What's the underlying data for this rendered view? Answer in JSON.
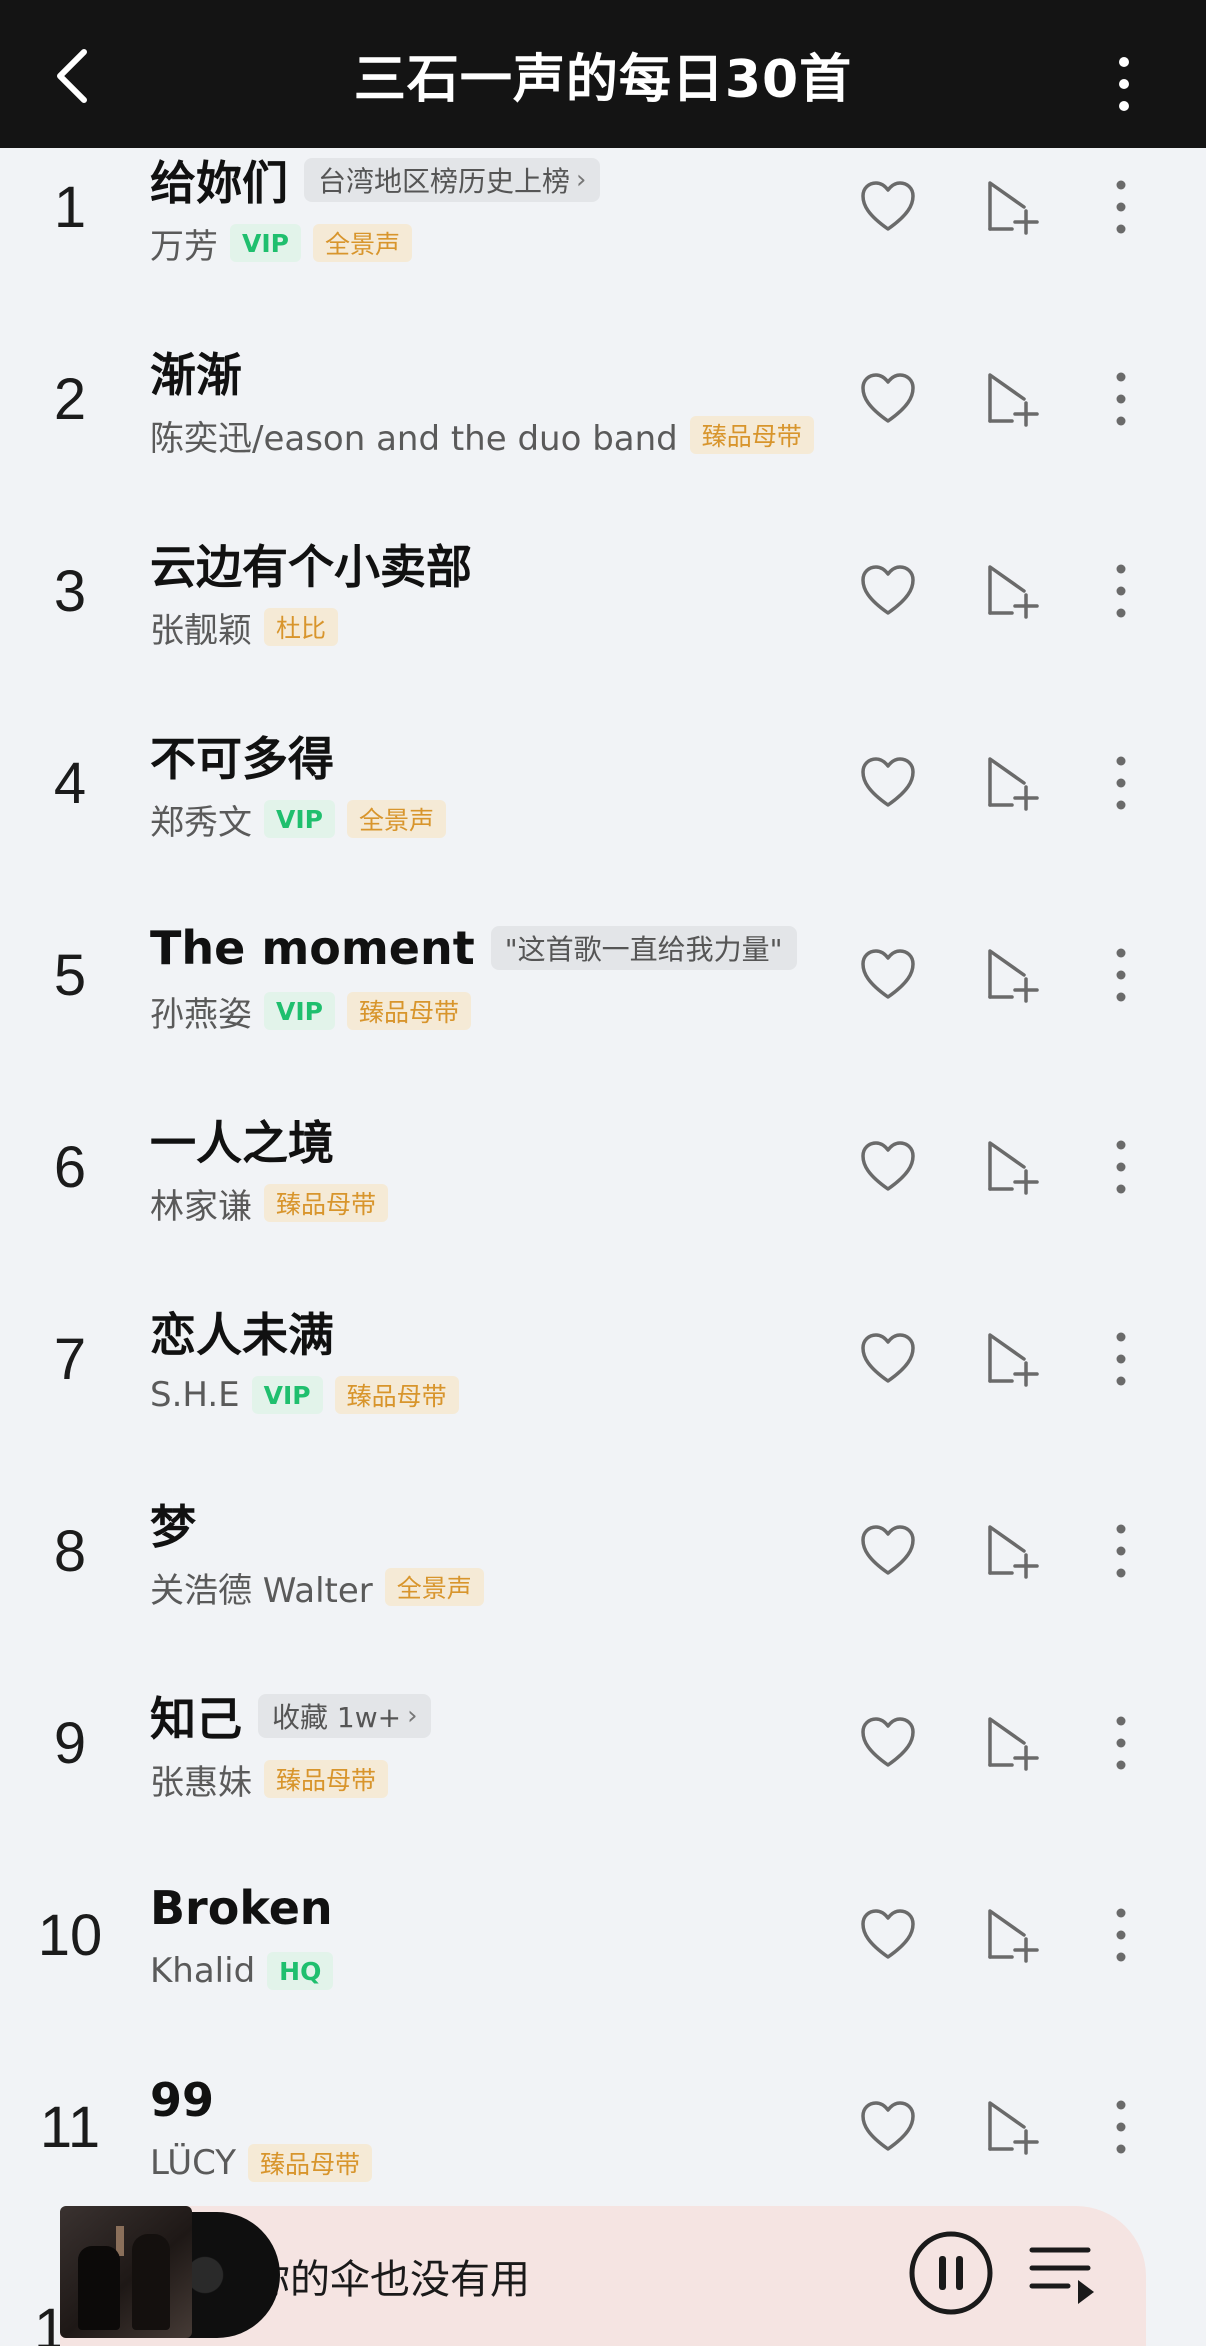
{
  "header": {
    "title": "三石一声的每日30首",
    "back_icon": "chevron-left-icon",
    "more_icon": "vertical-ellipsis-icon"
  },
  "songs": [
    {
      "index": "1",
      "title": "给妳们",
      "pill": "台湾地区榜历史上榜",
      "artist": "万芳",
      "tags": [
        {
          "text": "VIP",
          "kind": "vip"
        },
        {
          "text": "全景声",
          "kind": "gold"
        }
      ]
    },
    {
      "index": "2",
      "title": "渐渐",
      "artist": "陈奕迅/eason and the duo band",
      "tags": [
        {
          "text": "臻品母带",
          "kind": "gold"
        }
      ]
    },
    {
      "index": "3",
      "title": "云边有个小卖部",
      "artist": "张靓颖",
      "tags": [
        {
          "text": "杜比",
          "kind": "gold"
        }
      ]
    },
    {
      "index": "4",
      "title": "不可多得",
      "artist": "郑秀文",
      "tags": [
        {
          "text": "VIP",
          "kind": "vip"
        },
        {
          "text": "全景声",
          "kind": "gold"
        }
      ]
    },
    {
      "index": "5",
      "title": "The moment",
      "pill": "\"这首歌一直给我力量\"",
      "artist": "孙燕姿",
      "tags": [
        {
          "text": "VIP",
          "kind": "vip"
        },
        {
          "text": "臻品母带",
          "kind": "gold"
        }
      ]
    },
    {
      "index": "6",
      "title": "一人之境",
      "artist": "林家谦",
      "tags": [
        {
          "text": "臻品母带",
          "kind": "gold"
        }
      ]
    },
    {
      "index": "7",
      "title": "恋人未满",
      "artist": "S.H.E",
      "tags": [
        {
          "text": "VIP",
          "kind": "vip"
        },
        {
          "text": "臻品母带",
          "kind": "gold"
        }
      ]
    },
    {
      "index": "8",
      "title": "梦",
      "artist": "关浩德 Walter",
      "tags": [
        {
          "text": "全景声",
          "kind": "gold"
        }
      ]
    },
    {
      "index": "9",
      "title": "知己",
      "pill": "收藏 1w+",
      "artist": "张惠妹",
      "tags": [
        {
          "text": "臻品母带",
          "kind": "gold"
        }
      ]
    },
    {
      "index": "10",
      "title": "Broken",
      "artist": "Khalid",
      "tags": [
        {
          "text": "HQ",
          "kind": "vip"
        }
      ]
    },
    {
      "index": "11",
      "title": "99",
      "artist": "LÜCY",
      "tags": [
        {
          "text": "臻品母带",
          "kind": "gold"
        }
      ]
    }
  ],
  "partial_row_index": "1",
  "row_icons": {
    "like": "heart-icon",
    "add": "add-to-playlist-icon",
    "more": "vertical-ellipsis-icon"
  },
  "player": {
    "now_playing": "你的伞也没有用",
    "pause_icon": "pause-icon",
    "queue_icon": "playlist-queue-icon"
  },
  "colors": {
    "header_bg": "#141414",
    "page_bg": "#f1f3f6",
    "vip_green": "#1fbf6e",
    "gold": "#d8952c",
    "player_bg": "#f5e4e2"
  }
}
